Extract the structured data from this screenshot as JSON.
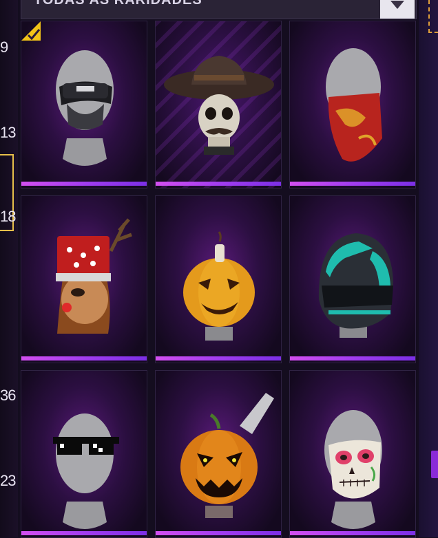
{
  "filter": {
    "label": "TODAS AS RARIDADES"
  },
  "left_numbers": [
    "9",
    "13",
    "18",
    "36",
    "23"
  ],
  "items": [
    {
      "name": "tactical-mask",
      "equipped": true
    },
    {
      "name": "skull-cowboy",
      "equipped": false
    },
    {
      "name": "red-bandana",
      "equipped": false
    },
    {
      "name": "reindeer-hat",
      "equipped": false
    },
    {
      "name": "pumpkin-head",
      "equipped": false
    },
    {
      "name": "teal-helmet",
      "equipped": false
    },
    {
      "name": "pixel-sunglasses",
      "equipped": false
    },
    {
      "name": "pumpkin-cleaver",
      "equipped": false
    },
    {
      "name": "sugar-skull-mask",
      "equipped": false
    }
  ],
  "colors": {
    "accent": "#c04cf0",
    "selection": "#e8c04a",
    "background": "#140d1f"
  }
}
